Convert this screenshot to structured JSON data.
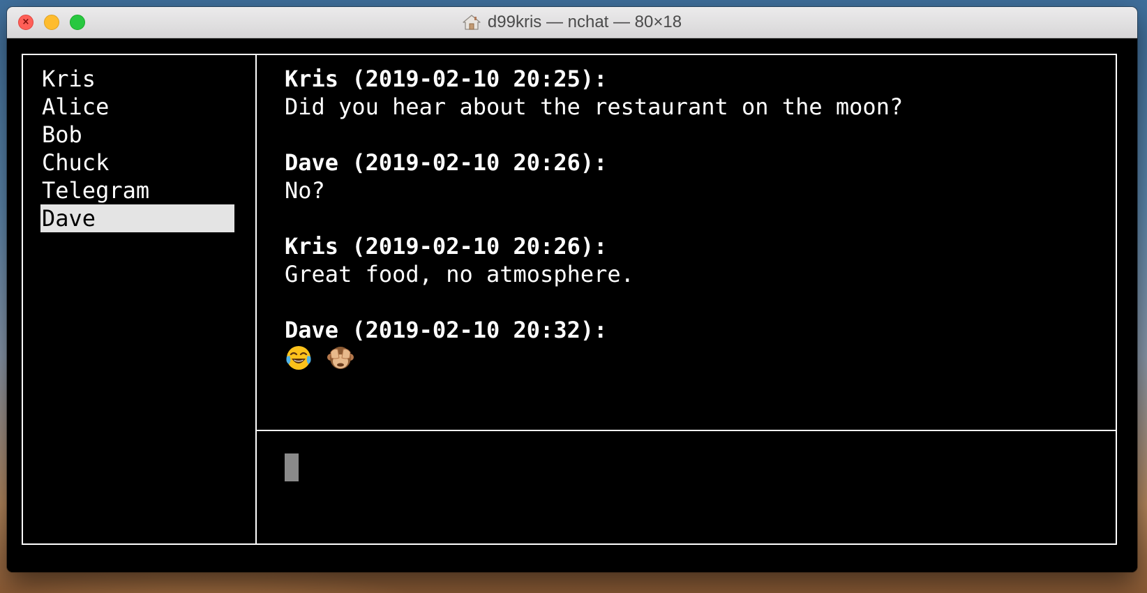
{
  "window": {
    "title": "d99kris — nchat — 80×18",
    "title_icon": "home-icon"
  },
  "contacts": [
    {
      "name": "Kris",
      "selected": false
    },
    {
      "name": "Alice",
      "selected": false
    },
    {
      "name": "Bob",
      "selected": false
    },
    {
      "name": "Chuck",
      "selected": false
    },
    {
      "name": "Telegram",
      "selected": false
    },
    {
      "name": "Dave",
      "selected": true
    }
  ],
  "messages": [
    {
      "header": "Kris (2019-02-10 20:25):",
      "body": "Did you hear about the restaurant on the moon?"
    },
    {
      "header": "Dave (2019-02-10 20:26):",
      "body": "No?"
    },
    {
      "header": "Kris (2019-02-10 20:26):",
      "body": "Great food, no atmosphere."
    },
    {
      "header": "Dave (2019-02-10 20:32):",
      "body": "",
      "emojis": [
        "face-with-tears-of-joy-emoji",
        "see-no-evil-monkey-emoji"
      ]
    }
  ],
  "input": {
    "value": ""
  },
  "colors": {
    "terminal_bg": "#000000",
    "terminal_fg": "#ffffff",
    "selection_bg": "#e4e4e4",
    "cursor": "#8a8a8a"
  }
}
